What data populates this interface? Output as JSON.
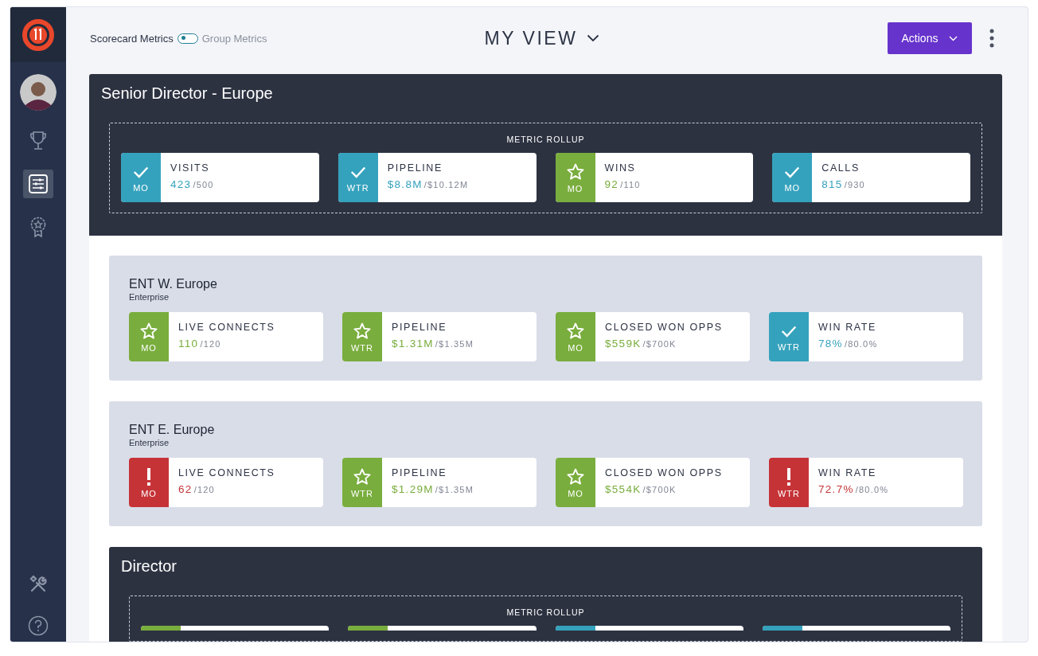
{
  "sidebar": {
    "items": [
      {
        "kind": "avatar",
        "selected": false
      },
      {
        "kind": "trophy",
        "selected": false
      },
      {
        "kind": "scorecard",
        "selected": true
      },
      {
        "kind": "award",
        "selected": false
      }
    ],
    "bottom_items": [
      {
        "kind": "tools"
      },
      {
        "kind": "help"
      }
    ]
  },
  "header": {
    "toggle": {
      "left_label": "Scorecard Metrics",
      "right_label": "Group Metrics",
      "on": false
    },
    "view_title": "MY VIEW",
    "actions_button": "Actions"
  },
  "scorecard": {
    "title": "Senior Director - Europe",
    "rollup_label": "METRIC ROLLUP",
    "metrics": [
      {
        "kind": "met",
        "period": "MO",
        "name": "VISITS",
        "value": "423",
        "target": "/500"
      },
      {
        "kind": "met",
        "period": "WTR",
        "name": "PIPELINE",
        "value": "$8.8M",
        "target": "/$10.12M"
      },
      {
        "kind": "exceeded",
        "period": "MO",
        "name": "WINS",
        "value": "92",
        "target": "/110"
      },
      {
        "kind": "met",
        "period": "MO",
        "name": "CALLS",
        "value": "815",
        "target": "/930"
      }
    ],
    "children": [
      {
        "kind": "group",
        "title": "ENT W. Europe",
        "subtitle": "Enterprise",
        "metrics": [
          {
            "kind": "exceeded",
            "period": "MO",
            "name": "LIVE CONNECTS",
            "value": "110",
            "target": "/120"
          },
          {
            "kind": "exceeded",
            "period": "WTR",
            "name": "PIPELINE",
            "value": "$1.31M",
            "target": "/$1.35M"
          },
          {
            "kind": "exceeded",
            "period": "MO",
            "name": "CLOSED WON OPPS",
            "value": "$559K",
            "target": "/$700K"
          },
          {
            "kind": "met",
            "period": "WTR",
            "name": "WIN RATE",
            "value": "78%",
            "target": "/80.0%"
          }
        ]
      },
      {
        "kind": "group",
        "title": "ENT E. Europe",
        "subtitle": "Enterprise",
        "metrics": [
          {
            "kind": "missed",
            "period": "MO",
            "name": "LIVE CONNECTS",
            "value": "62",
            "target": "/120"
          },
          {
            "kind": "exceeded",
            "period": "WTR",
            "name": "PIPELINE",
            "value": "$1.29M",
            "target": "/$1.35M"
          },
          {
            "kind": "exceeded",
            "period": "MO",
            "name": "CLOSED WON OPPS",
            "value": "$554K",
            "target": "/$700K"
          },
          {
            "kind": "missed",
            "period": "WTR",
            "name": "WIN RATE",
            "value": "72.7%",
            "target": "/80.0%"
          }
        ]
      },
      {
        "kind": "rollup",
        "title": "Director",
        "rollup_label": "METRIC ROLLUP",
        "metrics": [
          {
            "kind": "exceeded"
          },
          {
            "kind": "exceeded"
          },
          {
            "kind": "met"
          },
          {
            "kind": "met"
          }
        ]
      }
    ]
  }
}
